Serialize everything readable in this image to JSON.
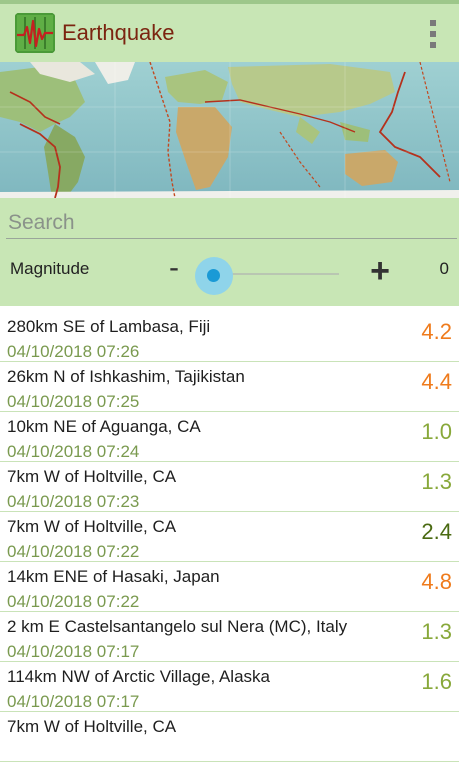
{
  "app": {
    "title": "Earthquake"
  },
  "search": {
    "placeholder": "Search",
    "value": ""
  },
  "filter": {
    "magnitude_label": "Magnitude",
    "minus_label": "-",
    "plus_label": "+",
    "magnitude_value": "0"
  },
  "colors": {
    "mag_high": "#ef7b1c",
    "mag_low": "#88a83a",
    "mag_mid": "#4a6a12"
  },
  "quakes": [
    {
      "place": "280km SE of Lambasa, Fiji",
      "time": "04/10/2018 07:26",
      "mag": "4.2",
      "level": "high"
    },
    {
      "place": "26km N of Ishkashim, Tajikistan",
      "time": "04/10/2018 07:25",
      "mag": "4.4",
      "level": "high"
    },
    {
      "place": "10km NE of Aguanga, CA",
      "time": "04/10/2018 07:24",
      "mag": "1.0",
      "level": "low"
    },
    {
      "place": "7km W of Holtville, CA",
      "time": "04/10/2018 07:23",
      "mag": "1.3",
      "level": "low"
    },
    {
      "place": "7km W of Holtville, CA",
      "time": "04/10/2018 07:22",
      "mag": "2.4",
      "level": "mid"
    },
    {
      "place": "14km ENE of Hasaki, Japan",
      "time": "04/10/2018 07:22",
      "mag": "4.8",
      "level": "high"
    },
    {
      "place": "2 km E Castelsantangelo sul Nera (MC), Italy",
      "time": "04/10/2018 07:17",
      "mag": "1.3",
      "level": "low"
    },
    {
      "place": "114km NW of Arctic Village, Alaska",
      "time": "04/10/2018 07:17",
      "mag": "1.6",
      "level": "low"
    },
    {
      "place": "7km W of Holtville, CA",
      "time": "",
      "mag": "",
      "level": "low"
    }
  ]
}
